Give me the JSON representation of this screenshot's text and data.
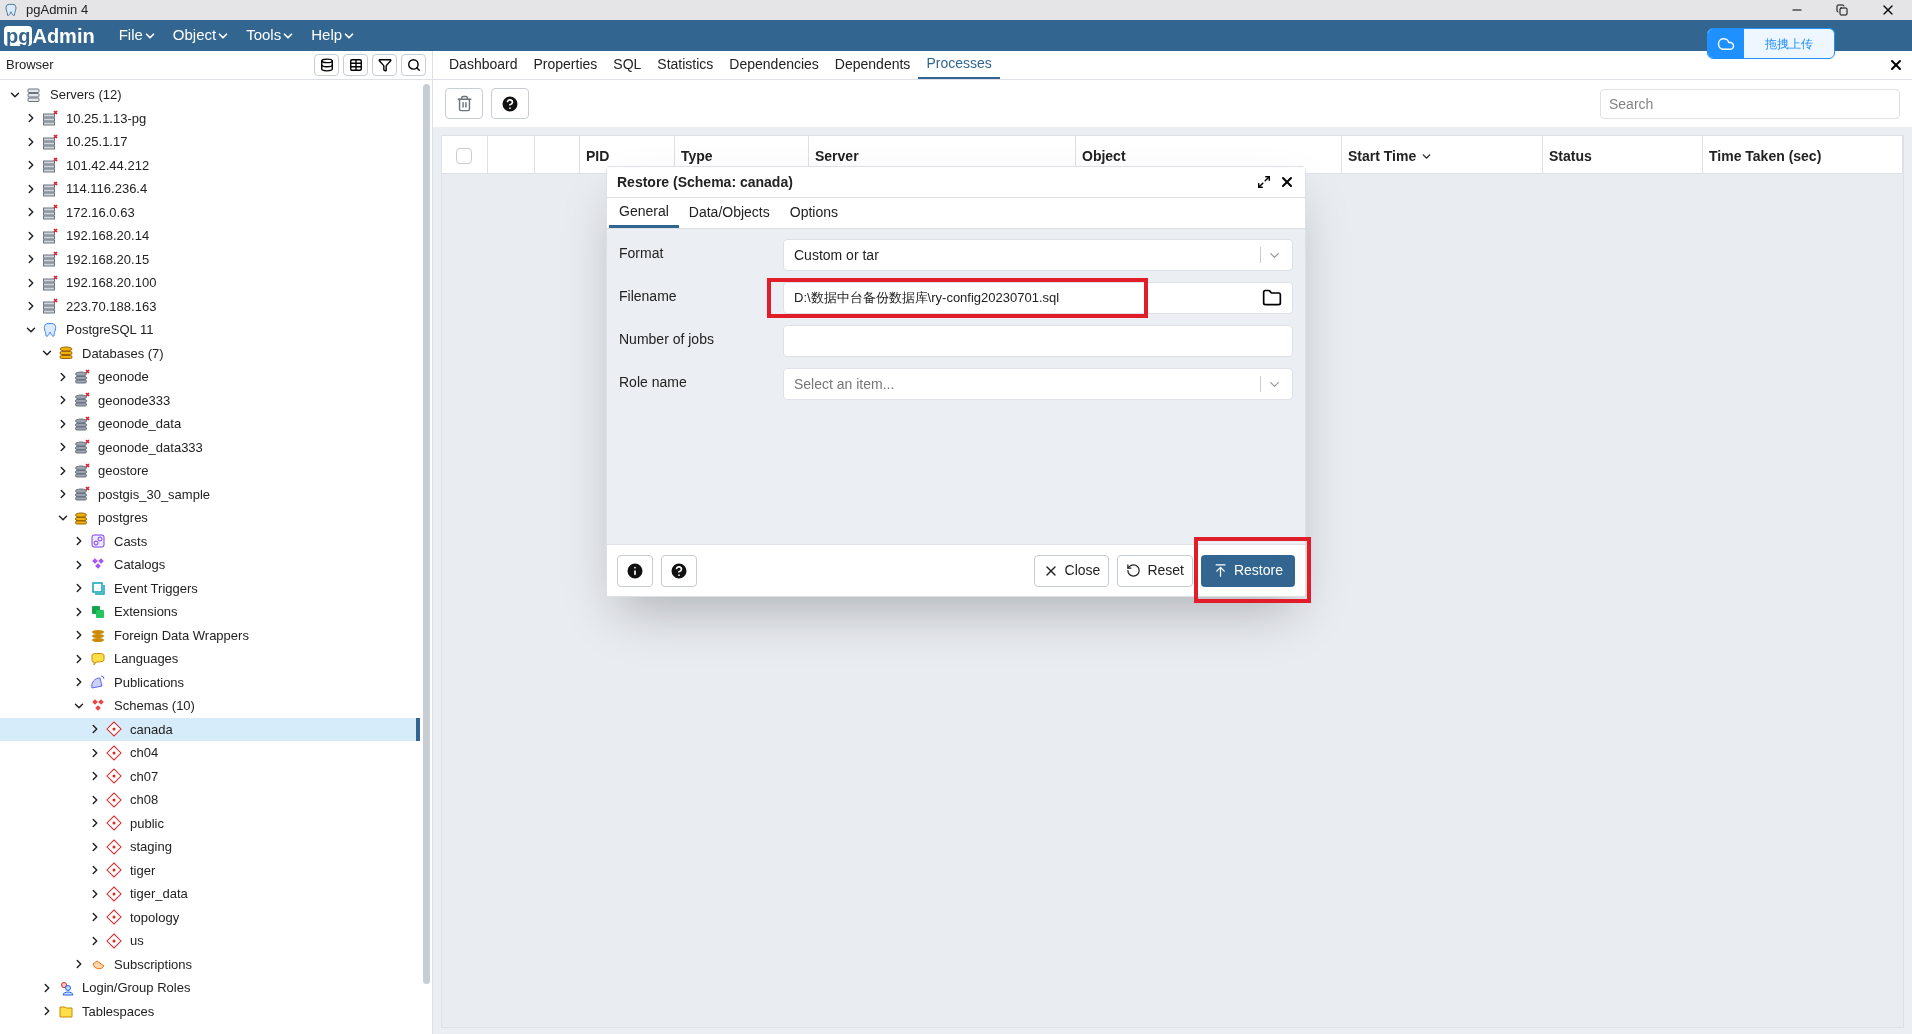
{
  "window": {
    "title": "pgAdmin 4"
  },
  "menubar": {
    "logo_prefix": "pg",
    "logo_name": "Admin",
    "menus": [
      "File",
      "Object",
      "Tools",
      "Help"
    ]
  },
  "upload_widget": {
    "label": "拖拽上传"
  },
  "browser": {
    "title": "Browser",
    "tree": [
      {
        "label": "Servers (12)",
        "kind": "server-group",
        "expanded": true,
        "selected": false,
        "children": [
          {
            "label": "10.25.1.13-pg",
            "kind": "server",
            "connected": false,
            "expanded": false,
            "selected": false
          },
          {
            "label": "10.25.1.17",
            "kind": "server",
            "connected": false,
            "expanded": false,
            "selected": false
          },
          {
            "label": "101.42.44.212",
            "kind": "server",
            "connected": false,
            "expanded": false,
            "selected": false
          },
          {
            "label": "114.116.236.4",
            "kind": "server",
            "connected": false,
            "expanded": false,
            "selected": false
          },
          {
            "label": "172.16.0.63",
            "kind": "server",
            "connected": false,
            "expanded": false,
            "selected": false
          },
          {
            "label": "192.168.20.14",
            "kind": "server",
            "connected": false,
            "expanded": false,
            "selected": false
          },
          {
            "label": "192.168.20.15",
            "kind": "server",
            "connected": false,
            "expanded": false,
            "selected": false
          },
          {
            "label": "192.168.20.100",
            "kind": "server",
            "connected": false,
            "expanded": false,
            "selected": false
          },
          {
            "label": "223.70.188.163",
            "kind": "server",
            "connected": false,
            "expanded": false,
            "selected": false
          },
          {
            "label": "PostgreSQL 11",
            "kind": "postgres",
            "expanded": true,
            "selected": false,
            "children": [
              {
                "label": "Databases (7)",
                "kind": "databases",
                "expanded": true,
                "selected": false,
                "children": [
                  {
                    "label": "geonode",
                    "kind": "database",
                    "connected": false,
                    "expanded": false,
                    "selected": false
                  },
                  {
                    "label": "geonode333",
                    "kind": "database",
                    "connected": false,
                    "expanded": false,
                    "selected": false
                  },
                  {
                    "label": "geonode_data",
                    "kind": "database",
                    "connected": false,
                    "expanded": false,
                    "selected": false
                  },
                  {
                    "label": "geonode_data333",
                    "kind": "database",
                    "connected": false,
                    "expanded": false,
                    "selected": false
                  },
                  {
                    "label": "geostore",
                    "kind": "database",
                    "connected": false,
                    "expanded": false,
                    "selected": false
                  },
                  {
                    "label": "postgis_30_sample",
                    "kind": "database",
                    "connected": false,
                    "expanded": false,
                    "selected": false
                  },
                  {
                    "label": "postgres",
                    "kind": "database",
                    "connected": true,
                    "expanded": true,
                    "selected": false,
                    "children": [
                      {
                        "label": "Casts",
                        "kind": "casts",
                        "expanded": false,
                        "selected": false
                      },
                      {
                        "label": "Catalogs",
                        "kind": "catalogs",
                        "expanded": false,
                        "selected": false
                      },
                      {
                        "label": "Event Triggers",
                        "kind": "event-triggers",
                        "expanded": false,
                        "selected": false
                      },
                      {
                        "label": "Extensions",
                        "kind": "extensions",
                        "expanded": false,
                        "selected": false
                      },
                      {
                        "label": "Foreign Data Wrappers",
                        "kind": "fdw",
                        "expanded": false,
                        "selected": false
                      },
                      {
                        "label": "Languages",
                        "kind": "languages",
                        "expanded": false,
                        "selected": false
                      },
                      {
                        "label": "Publications",
                        "kind": "publications",
                        "expanded": false,
                        "selected": false
                      },
                      {
                        "label": "Schemas (10)",
                        "kind": "schemas",
                        "expanded": true,
                        "selected": false,
                        "children": [
                          {
                            "label": "canada",
                            "kind": "schema",
                            "expanded": false,
                            "selected": true
                          },
                          {
                            "label": "ch04",
                            "kind": "schema",
                            "expanded": false,
                            "selected": false
                          },
                          {
                            "label": "ch07",
                            "kind": "schema",
                            "expanded": false,
                            "selected": false
                          },
                          {
                            "label": "ch08",
                            "kind": "schema",
                            "expanded": false,
                            "selected": false
                          },
                          {
                            "label": "public",
                            "kind": "schema",
                            "expanded": false,
                            "selected": false
                          },
                          {
                            "label": "staging",
                            "kind": "schema",
                            "expanded": false,
                            "selected": false
                          },
                          {
                            "label": "tiger",
                            "kind": "schema",
                            "expanded": false,
                            "selected": false
                          },
                          {
                            "label": "tiger_data",
                            "kind": "schema",
                            "expanded": false,
                            "selected": false
                          },
                          {
                            "label": "topology",
                            "kind": "schema",
                            "expanded": false,
                            "selected": false
                          },
                          {
                            "label": "us",
                            "kind": "schema",
                            "expanded": false,
                            "selected": false
                          }
                        ]
                      },
                      {
                        "label": "Subscriptions",
                        "kind": "subscriptions",
                        "expanded": false,
                        "selected": false
                      }
                    ]
                  }
                ]
              },
              {
                "label": "Login/Group Roles",
                "kind": "roles",
                "expanded": false,
                "selected": false
              },
              {
                "label": "Tablespaces",
                "kind": "tablespaces",
                "expanded": false,
                "selected": false
              }
            ]
          }
        ]
      }
    ]
  },
  "tabs": [
    {
      "label": "Dashboard",
      "selected": false
    },
    {
      "label": "Properties",
      "selected": false
    },
    {
      "label": "SQL",
      "selected": false
    },
    {
      "label": "Statistics",
      "selected": false
    },
    {
      "label": "Dependencies",
      "selected": false
    },
    {
      "label": "Dependents",
      "selected": false
    },
    {
      "label": "Processes",
      "selected": true
    }
  ],
  "search": {
    "placeholder": "Search"
  },
  "table": {
    "select_all": {
      "checked": false
    },
    "columns": [
      {
        "sorted": false
      },
      {
        "sorted": false
      },
      {
        "sorted": false
      },
      {
        "label": "PID",
        "sorted": false
      },
      {
        "label": "Type",
        "sorted": false
      },
      {
        "label": "Server",
        "sorted": false
      },
      {
        "label": "Object",
        "sorted": false
      },
      {
        "label": "Start Time",
        "sorted": true
      },
      {
        "label": "Status",
        "sorted": false
      },
      {
        "label": "Time Taken (sec)",
        "sorted": false
      }
    ]
  },
  "dialog": {
    "title": "Restore (Schema: canada)",
    "tabs": [
      {
        "label": "General",
        "selected": true
      },
      {
        "label": "Data/Objects",
        "selected": false
      },
      {
        "label": "Options",
        "selected": false
      }
    ],
    "fields": [
      {
        "label": "Format",
        "kind": "select",
        "value": "Custom or tar",
        "highlighted": false
      },
      {
        "label": "Filename",
        "kind": "file",
        "value": "D:\\数据中台备份数据库\\ry-config20230701.sql",
        "highlighted": true
      },
      {
        "label": "Number of jobs",
        "kind": "text",
        "highlighted": false
      },
      {
        "label": "Role name",
        "kind": "select",
        "placeholder": "Select an item...",
        "highlighted": false
      }
    ],
    "buttons": [
      {
        "label": "Close",
        "kind": "close",
        "highlighted": false
      },
      {
        "label": "Reset",
        "kind": "reset",
        "highlighted": false
      },
      {
        "label": "Restore",
        "kind": "primary",
        "highlighted": true
      }
    ]
  }
}
